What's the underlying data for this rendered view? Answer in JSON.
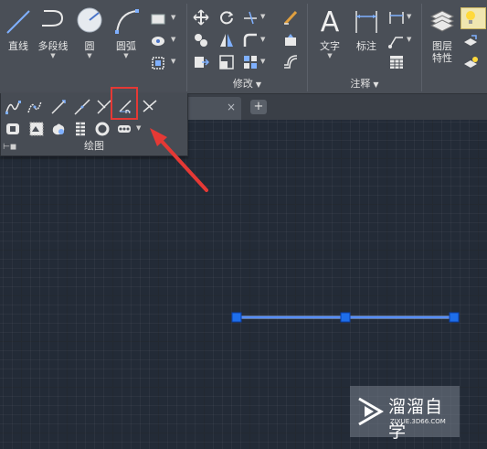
{
  "ribbon": {
    "draw": {
      "buttons": [
        {
          "label": "直线"
        },
        {
          "label": "多段线"
        },
        {
          "label": "圆"
        },
        {
          "label": "圆弧"
        }
      ],
      "title": "绘图"
    },
    "modify": {
      "title": "修改"
    },
    "annotation": {
      "title": "注释",
      "buttons": [
        {
          "label": "文字"
        },
        {
          "label": "标注"
        }
      ]
    },
    "layers": {
      "button": {
        "label_line1": "图层",
        "label_line2": "特性"
      }
    }
  },
  "tabs": {
    "close_glyph": "×",
    "add_glyph": "+"
  },
  "expanded_panel": {
    "title": "绘图",
    "highlighted_tool": "ray-icon"
  },
  "watermark": {
    "title": "溜溜自学",
    "url": "ZIXUE.3D66.COM"
  },
  "colors": {
    "canvas": "#232b37",
    "ribbon": "#4a4f57",
    "selection_line": "#3d7bff",
    "grip": "#1e6eea",
    "annotation_red": "#e53935"
  }
}
